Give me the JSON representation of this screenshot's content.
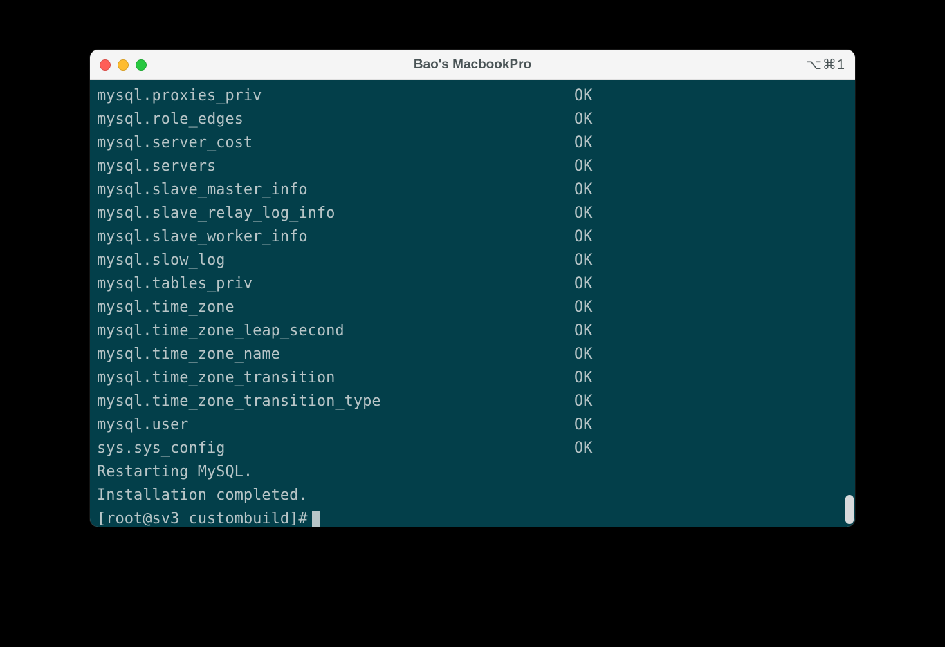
{
  "window": {
    "title": "Bao's MacbookPro",
    "shortcut": "⌥⌘1"
  },
  "terminal": {
    "rows": [
      {
        "name": "mysql.proxies_priv",
        "status": "OK"
      },
      {
        "name": "mysql.role_edges",
        "status": "OK"
      },
      {
        "name": "mysql.server_cost",
        "status": "OK"
      },
      {
        "name": "mysql.servers",
        "status": "OK"
      },
      {
        "name": "mysql.slave_master_info",
        "status": "OK"
      },
      {
        "name": "mysql.slave_relay_log_info",
        "status": "OK"
      },
      {
        "name": "mysql.slave_worker_info",
        "status": "OK"
      },
      {
        "name": "mysql.slow_log",
        "status": "OK"
      },
      {
        "name": "mysql.tables_priv",
        "status": "OK"
      },
      {
        "name": "mysql.time_zone",
        "status": "OK"
      },
      {
        "name": "mysql.time_zone_leap_second",
        "status": "OK"
      },
      {
        "name": "mysql.time_zone_name",
        "status": "OK"
      },
      {
        "name": "mysql.time_zone_transition",
        "status": "OK"
      },
      {
        "name": "mysql.time_zone_transition_type",
        "status": "OK"
      },
      {
        "name": "mysql.user",
        "status": "OK"
      },
      {
        "name": "sys.sys_config",
        "status": "OK"
      }
    ],
    "messages": [
      "Restarting MySQL.",
      "Installation completed."
    ],
    "prompt": "[root@sv3 custombuild]#"
  }
}
